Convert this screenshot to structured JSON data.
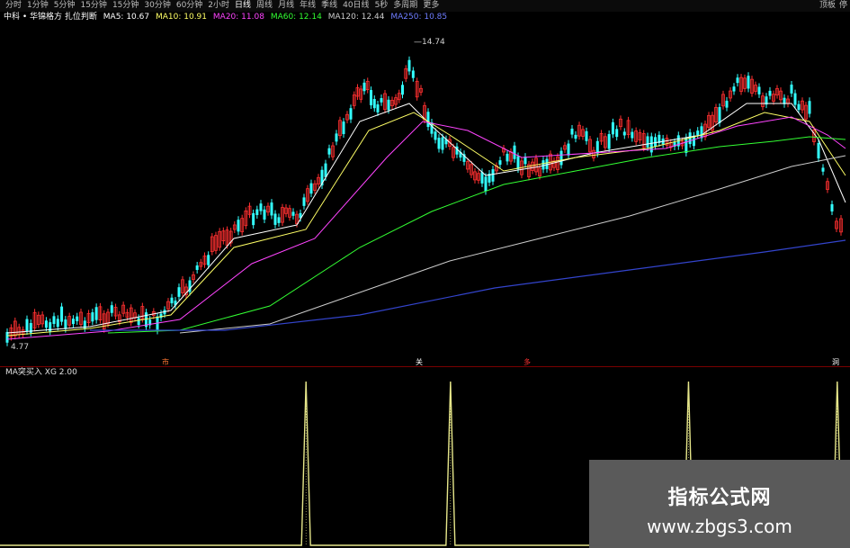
{
  "toolbar": {
    "items": [
      "分时",
      "1分钟",
      "5分钟",
      "15分钟",
      "15分钟",
      "30分钟",
      "60分钟",
      "2小时",
      "日线",
      "周线",
      "月线",
      "年线",
      "季线",
      "40日线",
      "5秒",
      "多周期",
      "更多"
    ],
    "active_index": 8,
    "right": [
      "顶板",
      "停"
    ]
  },
  "ma_legend": {
    "title": "中科 • 华锦格方 扎位判断",
    "ma5": "MA5: 10.67",
    "ma10": "MA10: 10.91",
    "ma20": "MA20: 11.08",
    "ma60": "MA60: 12.14",
    "ma120": "MA120: 12.44",
    "ma250": "MA250: 10.85",
    "colors": {
      "ma5": "#ffffff",
      "ma10": "#ffff66",
      "ma20": "#ff44ff",
      "ma60": "#33ff33",
      "ma120": "#cccccc",
      "ma250": "#5566ff"
    }
  },
  "price": {
    "high_label": "14.74",
    "low_label": "4.77"
  },
  "markers": [
    "市",
    "关",
    "多",
    "洞"
  ],
  "indicator": {
    "header": "MA突买入  XG 2.00",
    "signals": [
      0.36,
      0.53,
      0.81,
      0.985
    ]
  },
  "watermark": {
    "title": "指标公式网",
    "url": "www.zbgs3.com"
  }
}
